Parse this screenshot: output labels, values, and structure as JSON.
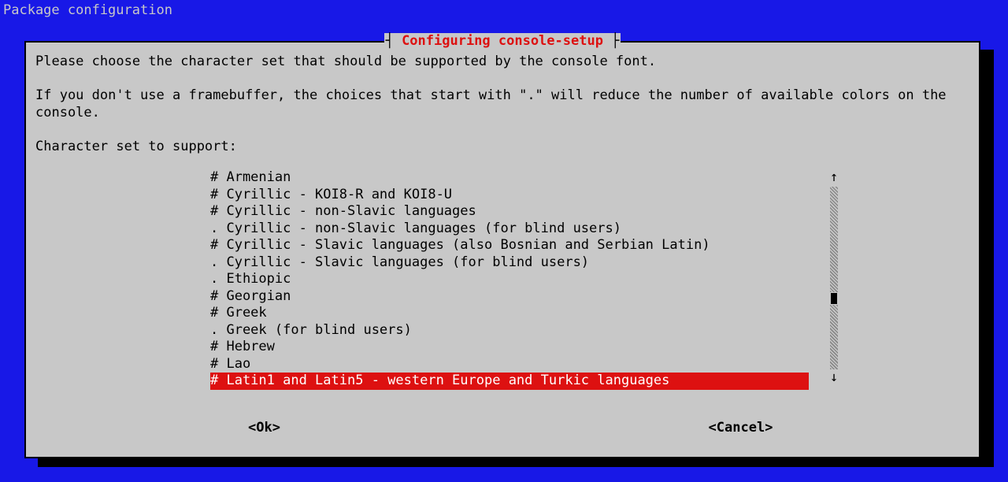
{
  "header": {
    "title": "Package configuration"
  },
  "dialog": {
    "title": "Configuring console-setup",
    "prompt_line1": "Please choose the character set that should be supported by the console font.",
    "prompt_line2": "If you don't use a framebuffer, the choices that start with \".\" will reduce the number of available colors on the console.",
    "prompt_label": "Character set to support:",
    "items": [
      {
        "marker": "#",
        "label": "Armenian",
        "selected": false
      },
      {
        "marker": "#",
        "label": "Cyrillic - KOI8-R and KOI8-U",
        "selected": false
      },
      {
        "marker": "#",
        "label": "Cyrillic - non-Slavic languages",
        "selected": false
      },
      {
        "marker": ".",
        "label": "Cyrillic - non-Slavic languages (for blind users)",
        "selected": false
      },
      {
        "marker": "#",
        "label": "Cyrillic - Slavic languages (also Bosnian and Serbian Latin)",
        "selected": false
      },
      {
        "marker": ".",
        "label": "Cyrillic - Slavic languages (for blind users)",
        "selected": false
      },
      {
        "marker": ".",
        "label": "Ethiopic",
        "selected": false
      },
      {
        "marker": "#",
        "label": "Georgian",
        "selected": false
      },
      {
        "marker": "#",
        "label": "Greek",
        "selected": false
      },
      {
        "marker": ".",
        "label": "Greek (for blind users)",
        "selected": false
      },
      {
        "marker": "#",
        "label": "Hebrew",
        "selected": false
      },
      {
        "marker": "#",
        "label": "Lao",
        "selected": false
      },
      {
        "marker": "#",
        "label": "Latin1 and Latin5 - western Europe and Turkic languages",
        "selected": true
      }
    ],
    "scroll": {
      "up_glyph": "↑",
      "down_glyph": "↓"
    },
    "buttons": {
      "ok": "<Ok>",
      "cancel": "<Cancel>"
    }
  }
}
